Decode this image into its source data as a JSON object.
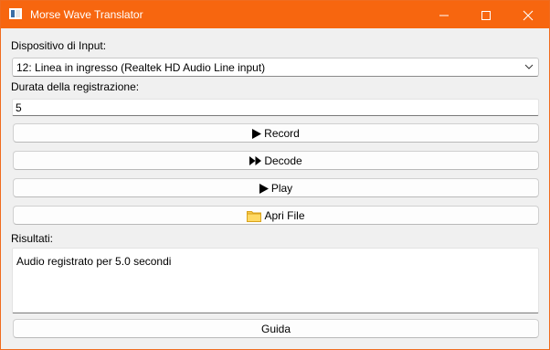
{
  "window": {
    "title": "Morse Wave Translator",
    "accent_color": "#f7660f",
    "controls": {
      "minimize_icon": "minimize-icon",
      "maximize_icon": "maximize-icon",
      "close_icon": "close-icon"
    }
  },
  "input_device": {
    "label": "Dispositivo di Input:",
    "selected": "12: Linea in ingresso (Realtek HD Audio Line input)"
  },
  "duration": {
    "label": "Durata della registrazione:",
    "value": "5"
  },
  "buttons": {
    "record": {
      "label": "Record",
      "icon": "play-icon"
    },
    "decode": {
      "label": "Decode",
      "icon": "fast-forward-icon"
    },
    "play": {
      "label": "Play",
      "icon": "play-icon"
    },
    "open_file": {
      "label": "Apri File",
      "icon": "folder-icon"
    },
    "guide": {
      "label": "Guida"
    }
  },
  "results": {
    "label": "Risultati:",
    "text": "Audio registrato per 5.0 secondi"
  }
}
